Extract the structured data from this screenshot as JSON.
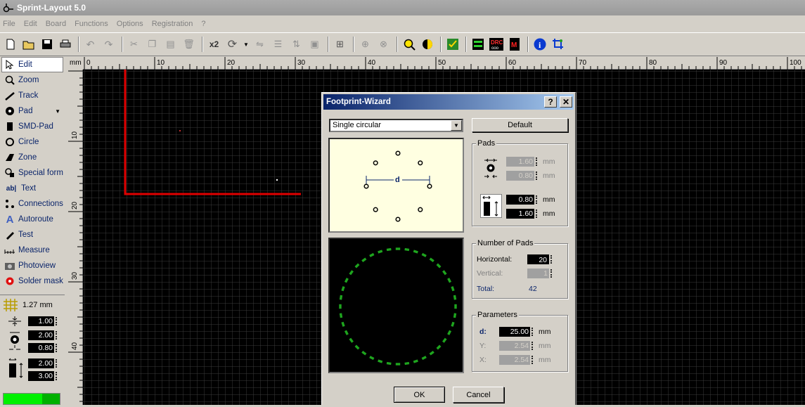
{
  "window": {
    "title": "Sprint-Layout 5.0"
  },
  "menu": [
    "File",
    "Edit",
    "Board",
    "Functions",
    "Options",
    "Registration",
    "?"
  ],
  "toolbar": {
    "multiply_label": "x2"
  },
  "sidebar": {
    "tools": [
      {
        "label": "Edit",
        "icon": "cursor-icon"
      },
      {
        "label": "Zoom",
        "icon": "magnifier-icon"
      },
      {
        "label": "Track",
        "icon": "track-icon"
      },
      {
        "label": "Pad",
        "icon": "pad-icon"
      },
      {
        "label": "SMD-Pad",
        "icon": "smd-pad-icon"
      },
      {
        "label": "Circle",
        "icon": "circle-icon"
      },
      {
        "label": "Zone",
        "icon": "zone-icon"
      },
      {
        "label": "Special form",
        "icon": "special-form-icon"
      },
      {
        "label": "Text",
        "icon": "text-icon"
      },
      {
        "label": "Connections",
        "icon": "connections-icon"
      },
      {
        "label": "Autoroute",
        "icon": "autoroute-icon"
      },
      {
        "label": "Test",
        "icon": "test-icon"
      },
      {
        "label": "Measure",
        "icon": "measure-icon"
      },
      {
        "label": "Photoview",
        "icon": "camera-icon"
      },
      {
        "label": "Solder mask",
        "icon": "solder-mask-icon"
      }
    ],
    "grid": "1.27 mm",
    "track_width": "1.00",
    "pad_outer": "2.00",
    "pad_inner": "0.80",
    "smd_width": "2.00",
    "smd_height": "3.00"
  },
  "ruler": {
    "unit": "mm",
    "top_labels": [
      "0",
      "10",
      "20",
      "30",
      "40",
      "50",
      "60",
      "70",
      "80",
      "90",
      "100"
    ],
    "left_labels": [
      "10",
      "20",
      "30",
      "40"
    ]
  },
  "dialog": {
    "title": "Footprint-Wizard",
    "help": "?",
    "close": "✕",
    "type_selected": "Single circular",
    "default_label": "Default",
    "diagram_label": "d",
    "pads": {
      "group_label": "Pads",
      "outer": "1.60",
      "inner": "0.80",
      "smd_w": "0.80",
      "smd_h": "1.60",
      "unit": "mm"
    },
    "number_of_pads": {
      "group_label": "Number of Pads",
      "horizontal_label": "Horizontal:",
      "horizontal": "20",
      "vertical_label": "Vertical:",
      "vertical": "1",
      "total_label": "Total:",
      "total": "42"
    },
    "parameters": {
      "group_label": "Parameters",
      "d_label": "d:",
      "d": "25.00",
      "y_label": "Y:",
      "y": "2.54",
      "x_label": "X:",
      "x": "2.54",
      "unit": "mm"
    },
    "ok_label": "OK",
    "cancel_label": "Cancel"
  },
  "colors": {
    "accent": "#0a246a",
    "track": "#e00000",
    "preview_pads": "#1ea51e",
    "grid": "#3a3a3a"
  }
}
